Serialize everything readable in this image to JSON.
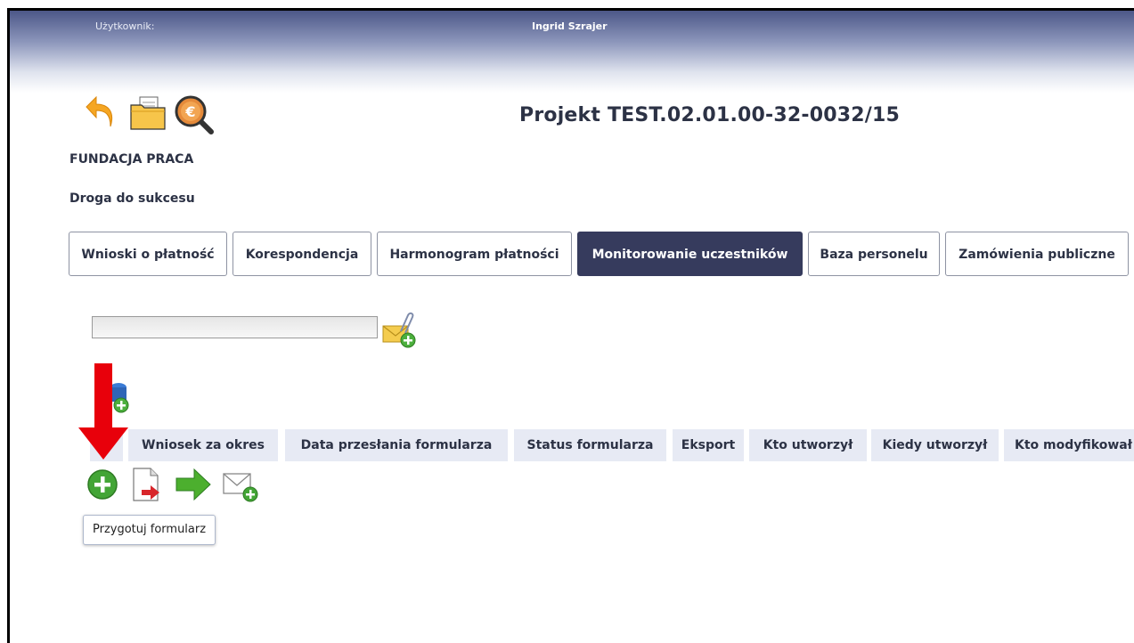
{
  "header": {
    "user_label": "Użytkownik:",
    "user_name": "Ingrid Szrajer"
  },
  "toolbar": {
    "icons": [
      "back-arrow-icon",
      "folder-icon",
      "euro-search-icon"
    ]
  },
  "project": {
    "title": "Projekt TEST.02.01.00-32-0032/15",
    "organization": "FUNDACJA PRACA",
    "name": "Droga do sukcesu"
  },
  "tabs": [
    {
      "label": "Wnioski o płatność",
      "active": false
    },
    {
      "label": "Korespondencja",
      "active": false
    },
    {
      "label": "Harmonogram płatności",
      "active": false
    },
    {
      "label": "Monitorowanie uczestników",
      "active": true
    },
    {
      "label": "Baza personelu",
      "active": false
    },
    {
      "label": "Zamówienia publiczne",
      "active": false
    }
  ],
  "search": {
    "value": "",
    "attach_icon": "attach-mail-add-icon"
  },
  "table": {
    "columns": [
      "",
      "Wniosek za okres",
      "Data przesłania formularza",
      "Status formularza",
      "Eksport",
      "Kto utworzył",
      "Kiedy utworzył",
      "Kto modyfikował"
    ]
  },
  "row_actions": [
    "add-circle-icon",
    "export-document-icon",
    "forward-arrow-icon",
    "mail-add-icon"
  ],
  "tooltip": "Przygotuj formularz",
  "colors": {
    "active_tab": "#363b5d",
    "header_dark": "#4c5788",
    "column_bg": "#e7eaf4",
    "annotation_arrow": "#e8000b"
  }
}
